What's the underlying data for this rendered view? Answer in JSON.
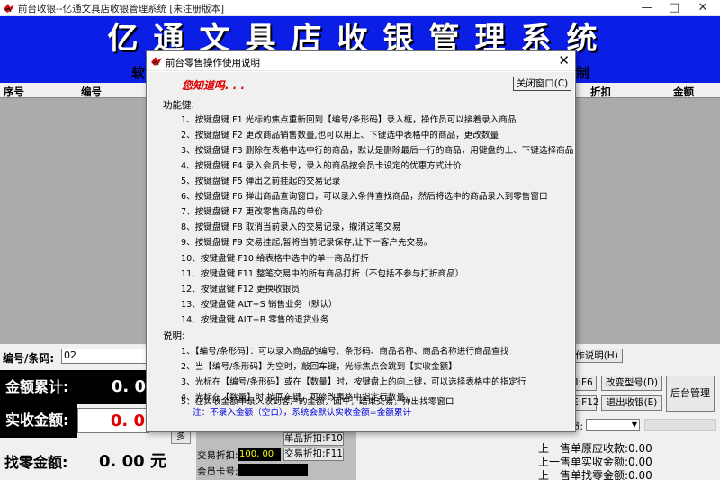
{
  "window": {
    "title": "前台收银--亿通文具店收银管理系统 [未注册版本]",
    "minimize": "—",
    "maximize": "□",
    "close": "✕"
  },
  "banner": {
    "text": "亿通文具店收银管理系统"
  },
  "subbanner": {
    "left": "软",
    "right": "制"
  },
  "grid": {
    "headers": [
      "序号",
      "编号",
      "折扣",
      "金额"
    ]
  },
  "form": {
    "code_label": "编号/条码:",
    "code_value": "02",
    "total_label": "金额累计:",
    "total_value": "0. 0",
    "paid_label": "实收金额:",
    "paid_value": "0. 0",
    "change_label": "找零金额:",
    "change_value": "0. 00 元",
    "more_button": "多",
    "discount_label": "交易折扣:",
    "discount_value": "100. 00",
    "member_label": "会员卡号:",
    "item_discount_button": "单品折扣:F10",
    "trans_discount_button": "交易折扣:F11"
  },
  "right_panel": {
    "op_guide_button": "作说明(H)",
    "f6_button": "I:F6",
    "f12_button": "E:F12",
    "change_type_button": "改变型号(D)",
    "logout_button": "退出收银(E)",
    "admin_button": "后台管理",
    "combo_label": "员:",
    "last_received": "上一售单原应收款:0.00",
    "last_paid": "上一售单实收金额:0.00",
    "last_change": "上一售单找零金额:0.00"
  },
  "dialog": {
    "title": "前台零售操作使用说明",
    "close": "✕",
    "header": "您知道吗. . .",
    "close_button": "关闭窗口(C)",
    "functions_title": "功能键:",
    "functions": [
      "1、按键盘键 F1 光标的焦点重新回到【编号/条形码】录入框，操作员可以接着录入商品",
      "2、按键盘键 F2 更改商品销售数量,也可以用上、下键选中表格中的商品，更改数量",
      "3、按键盘键 F3 删除在表格中选中行的商品，默认是删除最后一行的商品，用键盘的上、下键选择商品",
      "4、按键盘键 F4 录入会员卡号，录入的商品按会员卡设定的优惠方式计价",
      "5、按键盘键 F5 弹出之前挂起的交易记录",
      "6、按键盘键 F6 弹出商品查询窗口，可以录入条件查找商品，然后将选中的商品录入到零售窗口",
      "7、按键盘键 F7 更改零售商品的单价",
      "8、按键盘键 F8 取消当前录入的交易记录，撤消这笔交易",
      "9、按键盘键 F9 交易挂起,暂将当前记录保存,让下一客户先交易。",
      "10、按键盘键 F10 给表格中选中的单一商品打折",
      "11、按键盘键 F11 整笔交易中的所有商品打折（不包括不参与打折商品）",
      "12、按键盘键 F12 更换收银员",
      "13、按键盘键 ALT+S 销售业务（默认）",
      "14、按键盘键 ALT+B 零售的退货业务"
    ],
    "notes_title": "说明:",
    "notes": [
      "1、【编号/条形码】：可以录入商品的编号、条形码、商品名称、商品名称进行商品查找",
      "2、当【编号/条形码】为空时，敲回车键，光标焦点会跳到【实收金额】",
      "3、光标在【编号/条形码】或在【数量】时，按键盘上的向上键，可以选择表格中的指定行",
      "4、光标在【数量】时,按回车键，可修改表格中指定行数量",
      "5、在实收金额中录入收到客户的金额，回车，结束交易，弹出找零窗口"
    ],
    "tip": "注：不录入金额（空白），系统会默认实收金额=金额累计"
  },
  "colors": {
    "banner": "#0a1ee6",
    "grid": "#ababab",
    "dialog_header": "#e00000",
    "tip": "#0000e0"
  }
}
